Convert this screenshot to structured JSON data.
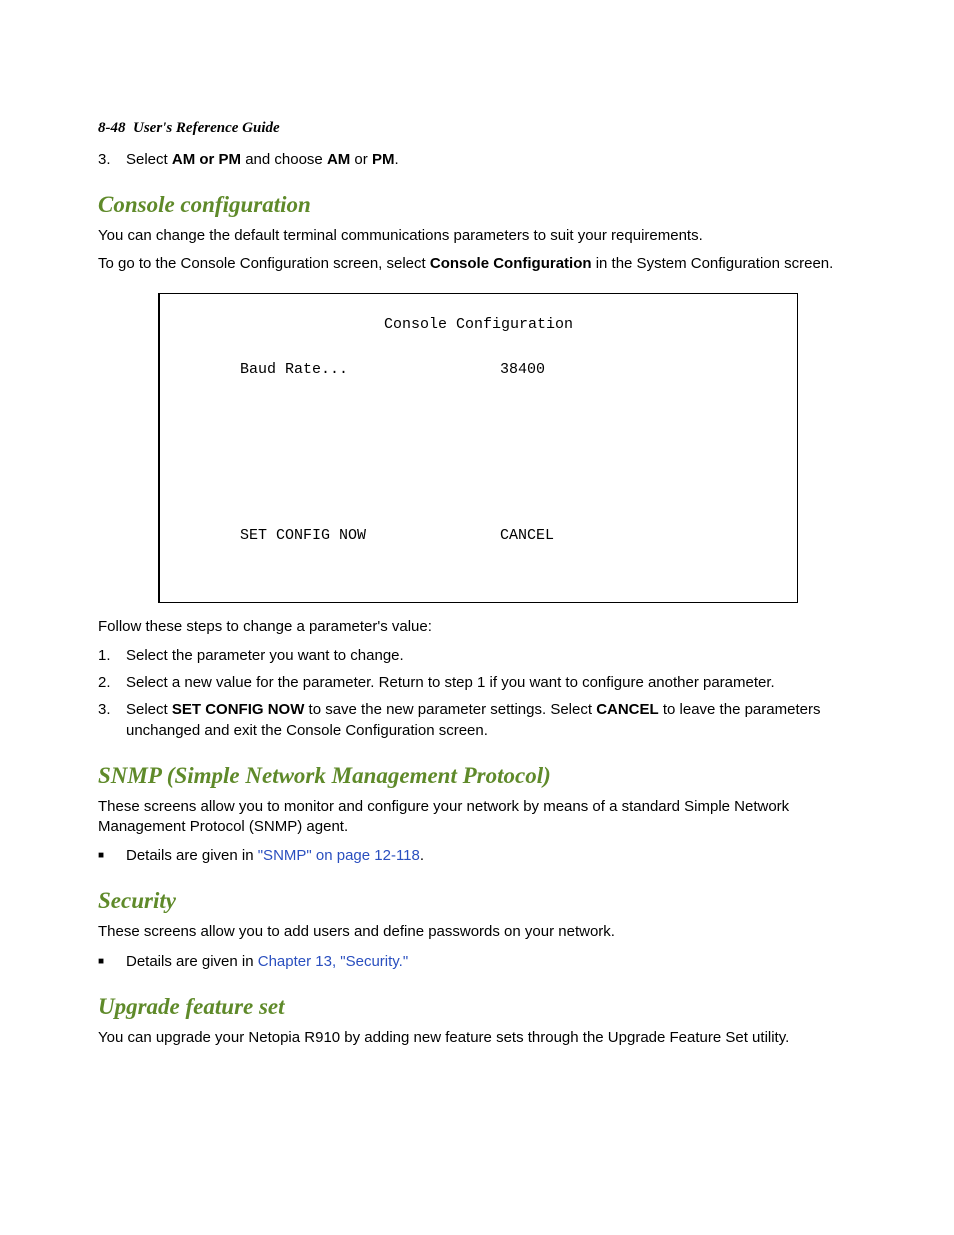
{
  "header": {
    "page_number": "8-48",
    "guide_title": "User's Reference Guide"
  },
  "intro_step": {
    "num": "3.",
    "pre": "Select ",
    "bold1": "AM or PM",
    "mid": " and choose ",
    "bold2": "AM",
    "or": " or ",
    "bold3": "PM",
    "end": "."
  },
  "console": {
    "heading": "Console configuration",
    "p1": "You can change the default terminal communications parameters to suit your requirements.",
    "p2_pre": "To go to the Console Configuration screen, select ",
    "p2_bold": "Console Configuration",
    "p2_post": " in the System Configuration screen.",
    "term": {
      "title": "Console Configuration",
      "row_label": "Baud Rate...",
      "row_value": "38400",
      "action_left": "SET CONFIG NOW",
      "action_right": "CANCEL"
    },
    "follow_intro": "Follow these steps to change a parameter's value:",
    "steps": [
      {
        "num": "1.",
        "text": "Select the parameter you want to change."
      },
      {
        "num": "2.",
        "text": "Select a new value for the parameter. Return to step 1 if you want to configure another parameter."
      }
    ],
    "step3": {
      "num": "3.",
      "pre": "Select ",
      "b1": "SET CONFIG NOW",
      "mid": " to save the new parameter settings. Select ",
      "b2": "CANCEL",
      "post": " to leave the parameters unchanged and exit the Console Configuration screen."
    }
  },
  "snmp": {
    "heading": "SNMP (Simple Network Management Protocol)",
    "p1": "These screens allow you to monitor and configure your network by means of a standard Simple Network Management Protocol (SNMP) agent.",
    "bullet_pre": "Details are given in ",
    "bullet_link": "\"SNMP\" on page 12-118",
    "bullet_post": "."
  },
  "security": {
    "heading": "Security",
    "p1": "These screens allow you to add users and define passwords on your network.",
    "bullet_pre": "Details are given in ",
    "bullet_link": "Chapter 13, \"Security.\""
  },
  "upgrade": {
    "heading": "Upgrade feature set",
    "p1": "You can upgrade your Netopia R910 by adding new feature sets through the Upgrade Feature Set utility."
  }
}
